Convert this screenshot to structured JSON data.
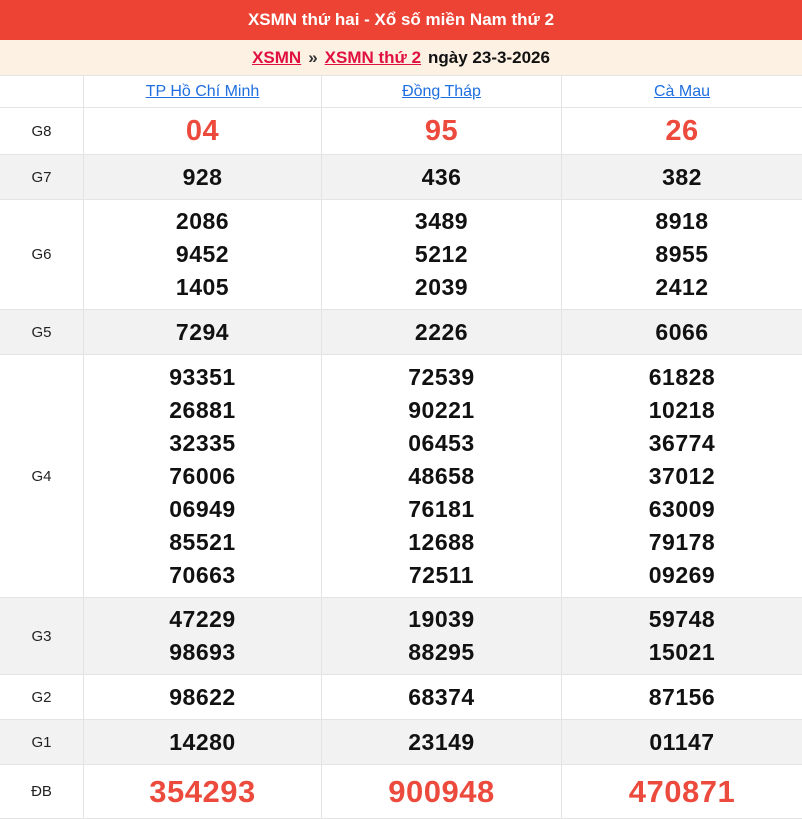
{
  "header": {
    "title": "XSMN thứ hai - Xổ số miền Nam thứ 2"
  },
  "breadcrumb": {
    "links": [
      {
        "label": "XSMN"
      },
      {
        "label": "XSMN thứ 2"
      }
    ],
    "separator": "»",
    "date_text": "ngày 23-3-2026"
  },
  "table": {
    "columns": [
      "TP Hồ Chí Minh",
      "Đồng Tháp",
      "Cà Mau"
    ],
    "rows": [
      {
        "label": "G8",
        "highlight": true,
        "shade": false,
        "cells": [
          [
            "04"
          ],
          [
            "95"
          ],
          [
            "26"
          ]
        ]
      },
      {
        "label": "G7",
        "highlight": false,
        "shade": true,
        "cells": [
          [
            "928"
          ],
          [
            "436"
          ],
          [
            "382"
          ]
        ]
      },
      {
        "label": "G6",
        "highlight": false,
        "shade": false,
        "cells": [
          [
            "2086",
            "9452",
            "1405"
          ],
          [
            "3489",
            "5212",
            "2039"
          ],
          [
            "8918",
            "8955",
            "2412"
          ]
        ]
      },
      {
        "label": "G5",
        "highlight": false,
        "shade": true,
        "cells": [
          [
            "7294"
          ],
          [
            "2226"
          ],
          [
            "6066"
          ]
        ]
      },
      {
        "label": "G4",
        "highlight": false,
        "shade": false,
        "cells": [
          [
            "93351",
            "26881",
            "32335",
            "76006",
            "06949",
            "85521",
            "70663"
          ],
          [
            "72539",
            "90221",
            "06453",
            "48658",
            "76181",
            "12688",
            "72511"
          ],
          [
            "61828",
            "10218",
            "36774",
            "37012",
            "63009",
            "79178",
            "09269"
          ]
        ]
      },
      {
        "label": "G3",
        "highlight": false,
        "shade": true,
        "cells": [
          [
            "47229",
            "98693"
          ],
          [
            "19039",
            "88295"
          ],
          [
            "59748",
            "15021"
          ]
        ]
      },
      {
        "label": "G2",
        "highlight": false,
        "shade": false,
        "cells": [
          [
            "98622"
          ],
          [
            "68374"
          ],
          [
            "87156"
          ]
        ]
      },
      {
        "label": "G1",
        "highlight": false,
        "shade": true,
        "cells": [
          [
            "14280"
          ],
          [
            "23149"
          ],
          [
            "01147"
          ]
        ]
      },
      {
        "label": "ĐB",
        "highlight": true,
        "shade": false,
        "cells": [
          [
            "354293"
          ],
          [
            "900948"
          ],
          [
            "470871"
          ]
        ]
      }
    ]
  },
  "colors": {
    "title_bar_bg": "#ec4335",
    "breadcrumb_bg": "#fdf1e3",
    "highlight_number": "#ec4a3d",
    "breadcrumb_link": "#e0113f",
    "province_link": "#1f6fe0",
    "stripe_row_bg": "#f2f2f2",
    "border": "#e4e4e4"
  }
}
